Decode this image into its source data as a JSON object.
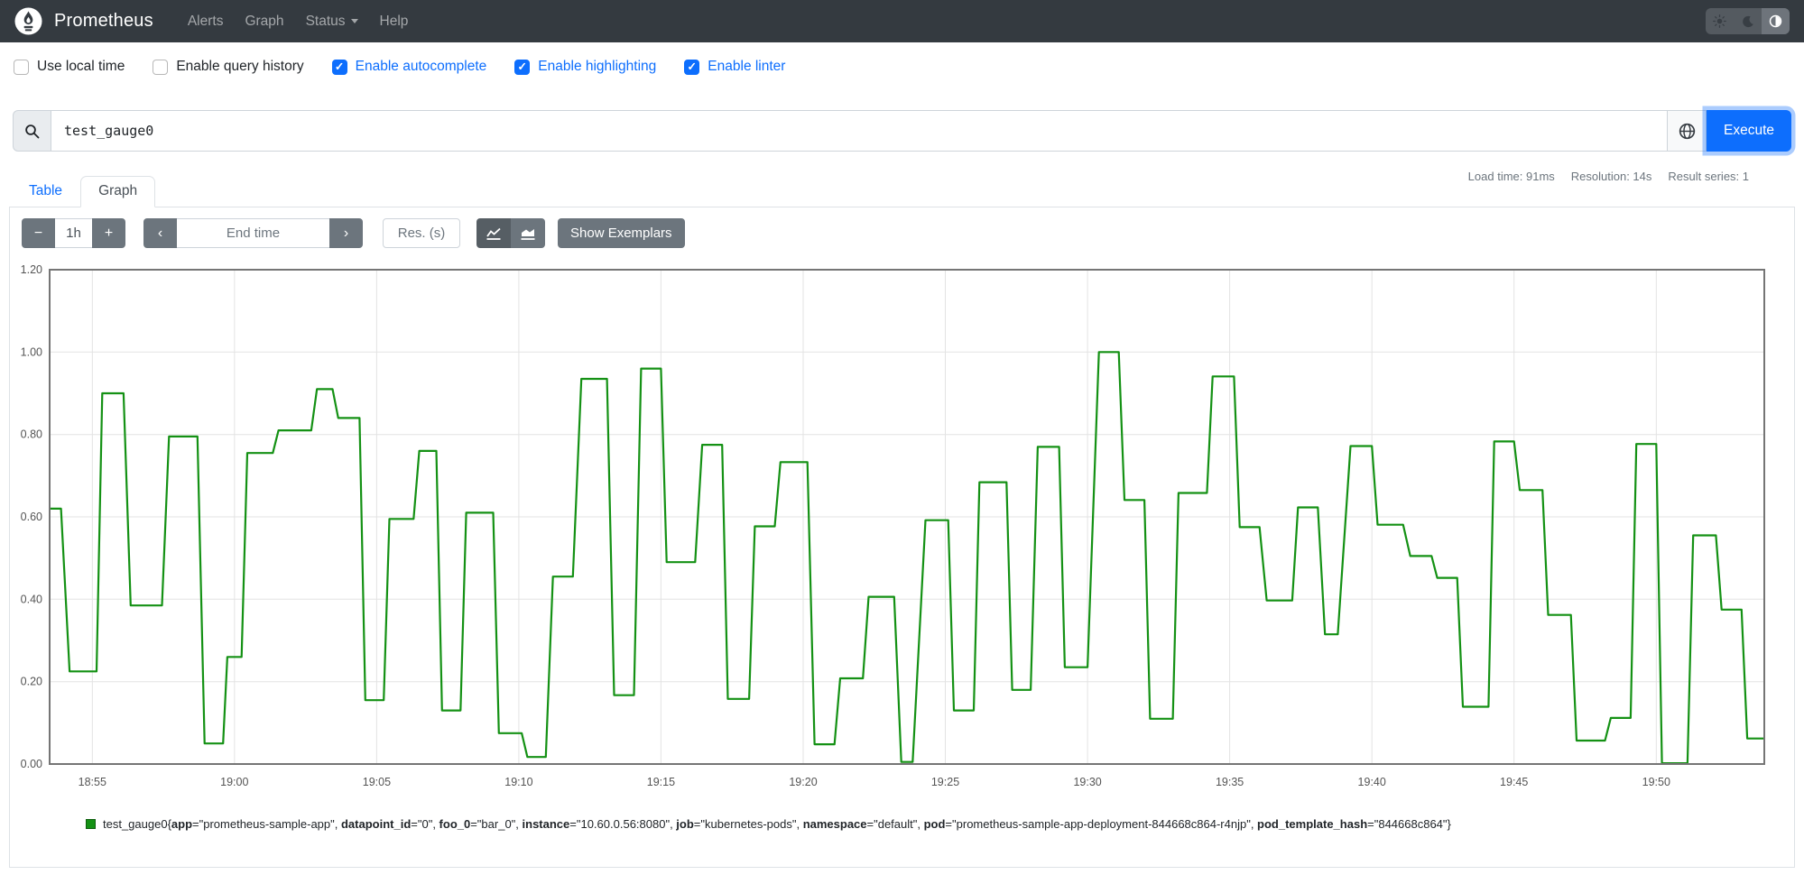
{
  "navbar": {
    "brand": "Prometheus",
    "links": [
      {
        "label": "Alerts"
      },
      {
        "label": "Graph"
      },
      {
        "label": "Status"
      },
      {
        "label": "Help"
      }
    ],
    "theme_toggle": {
      "active_index": 2
    }
  },
  "options": {
    "items": [
      {
        "label": "Use local time",
        "checked": false
      },
      {
        "label": "Enable query history",
        "checked": false
      },
      {
        "label": "Enable autocomplete",
        "checked": true
      },
      {
        "label": "Enable highlighting",
        "checked": true
      },
      {
        "label": "Enable linter",
        "checked": true
      }
    ]
  },
  "query": {
    "value": "test_gauge0",
    "execute_label": "Execute"
  },
  "stats": {
    "load_time": "Load time: 91ms",
    "resolution": "Resolution: 14s",
    "result_series": "Result series: 1"
  },
  "tabs": [
    {
      "label": "Table",
      "active": false
    },
    {
      "label": "Graph",
      "active": true
    }
  ],
  "graph_controls": {
    "duration_minus": "−",
    "duration": "1h",
    "duration_plus": "+",
    "back": "‹",
    "end_time_placeholder": "End time",
    "forward": "›",
    "res_placeholder": "Res. (s)",
    "show_exemplars": "Show Exemplars"
  },
  "chart_data": {
    "type": "line",
    "line_color": "#149114",
    "ylim": [
      0,
      1.2
    ],
    "yticks": [
      "0.00",
      "0.20",
      "0.40",
      "0.60",
      "0.80",
      "1.00",
      "1.20"
    ],
    "x_total_minutes": 60.3,
    "xticks": [
      {
        "label": "18:55",
        "min": 1.5
      },
      {
        "label": "19:00",
        "min": 6.5
      },
      {
        "label": "19:05",
        "min": 11.5
      },
      {
        "label": "19:10",
        "min": 16.5
      },
      {
        "label": "19:15",
        "min": 21.5
      },
      {
        "label": "19:20",
        "min": 26.5
      },
      {
        "label": "19:25",
        "min": 31.5
      },
      {
        "label": "19:30",
        "min": 36.5
      },
      {
        "label": "19:35",
        "min": 41.5
      },
      {
        "label": "19:40",
        "min": 46.5
      },
      {
        "label": "19:45",
        "min": 51.5
      },
      {
        "label": "19:50",
        "min": 56.5
      }
    ],
    "segments": [
      [
        0,
        0.4,
        0.62
      ],
      [
        0.7,
        1.65,
        0.225
      ],
      [
        1.85,
        2.6,
        0.9
      ],
      [
        2.85,
        3.95,
        0.385
      ],
      [
        4.2,
        5.2,
        0.795
      ],
      [
        5.45,
        6.1,
        0.05
      ],
      [
        6.25,
        6.75,
        0.26
      ],
      [
        6.95,
        7.85,
        0.755
      ],
      [
        8.05,
        9.2,
        0.81
      ],
      [
        9.4,
        9.95,
        0.91
      ],
      [
        10.15,
        10.9,
        0.84
      ],
      [
        11.1,
        11.75,
        0.155
      ],
      [
        11.95,
        12.8,
        0.595
      ],
      [
        13.0,
        13.6,
        0.76
      ],
      [
        13.8,
        14.45,
        0.13
      ],
      [
        14.65,
        15.6,
        0.61
      ],
      [
        15.8,
        16.6,
        0.075
      ],
      [
        16.8,
        17.45,
        0.017
      ],
      [
        17.7,
        18.4,
        0.455
      ],
      [
        18.7,
        19.6,
        0.935
      ],
      [
        19.85,
        20.55,
        0.167
      ],
      [
        20.8,
        21.5,
        0.96
      ],
      [
        21.7,
        22.7,
        0.49
      ],
      [
        22.95,
        23.65,
        0.775
      ],
      [
        23.85,
        24.6,
        0.158
      ],
      [
        24.8,
        25.5,
        0.577
      ],
      [
        25.7,
        26.65,
        0.733
      ],
      [
        26.9,
        27.6,
        0.048
      ],
      [
        27.8,
        28.6,
        0.208
      ],
      [
        28.8,
        29.7,
        0.406
      ],
      [
        29.95,
        30.35,
        0.005
      ],
      [
        30.8,
        31.6,
        0.592
      ],
      [
        31.8,
        32.5,
        0.13
      ],
      [
        32.7,
        33.65,
        0.684
      ],
      [
        33.85,
        34.5,
        0.18
      ],
      [
        34.75,
        35.5,
        0.77
      ],
      [
        35.7,
        36.5,
        0.235
      ],
      [
        36.9,
        37.6,
        1.0
      ],
      [
        37.8,
        38.5,
        0.641
      ],
      [
        38.7,
        39.5,
        0.11
      ],
      [
        39.7,
        40.7,
        0.658
      ],
      [
        40.9,
        41.65,
        0.941
      ],
      [
        41.85,
        42.55,
        0.575
      ],
      [
        42.8,
        43.7,
        0.397
      ],
      [
        43.9,
        44.6,
        0.623
      ],
      [
        44.85,
        45.3,
        0.315
      ],
      [
        45.75,
        46.5,
        0.772
      ],
      [
        46.7,
        47.6,
        0.581
      ],
      [
        47.85,
        48.6,
        0.505
      ],
      [
        48.8,
        49.5,
        0.452
      ],
      [
        49.7,
        50.6,
        0.139
      ],
      [
        50.8,
        51.5,
        0.783
      ],
      [
        51.7,
        52.5,
        0.665
      ],
      [
        52.7,
        53.5,
        0.362
      ],
      [
        53.7,
        54.7,
        0.057
      ],
      [
        54.9,
        55.6,
        0.112
      ],
      [
        55.8,
        56.5,
        0.777
      ],
      [
        56.7,
        57.6,
        0.002
      ],
      [
        57.8,
        58.6,
        0.555
      ],
      [
        58.8,
        59.5,
        0.375
      ],
      [
        59.7,
        60.3,
        0.062
      ]
    ]
  },
  "legend": {
    "metric": "test_gauge0",
    "labels": [
      {
        "name": "app",
        "value": "prometheus-sample-app"
      },
      {
        "name": "datapoint_id",
        "value": "0"
      },
      {
        "name": "foo_0",
        "value": "bar_0"
      },
      {
        "name": "instance",
        "value": "10.60.0.56:8080"
      },
      {
        "name": "job",
        "value": "kubernetes-pods"
      },
      {
        "name": "namespace",
        "value": "default"
      },
      {
        "name": "pod",
        "value": "prometheus-sample-app-deployment-844668c864-r4njp"
      },
      {
        "name": "pod_template_hash",
        "value": "844668c864"
      }
    ]
  }
}
